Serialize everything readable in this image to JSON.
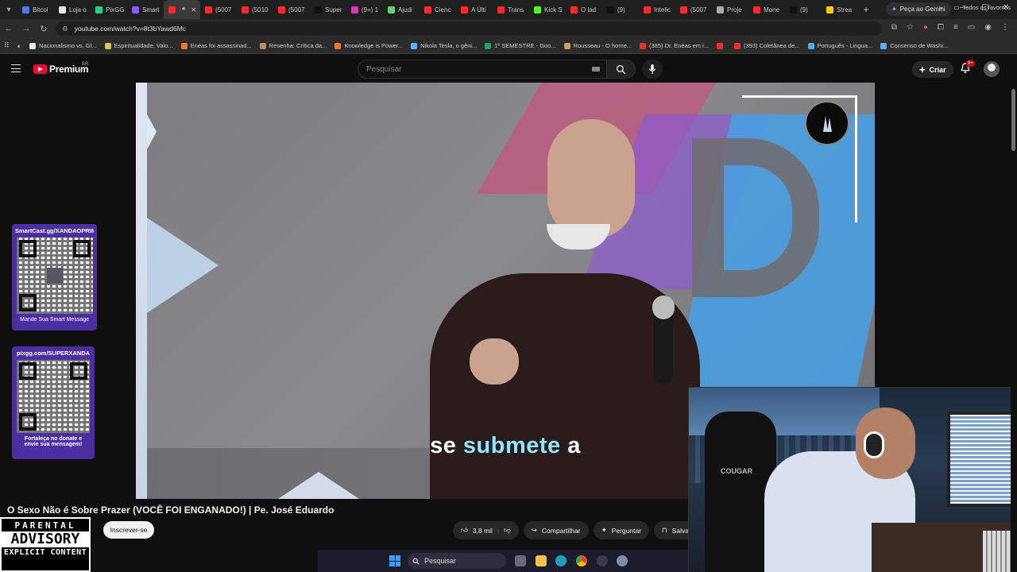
{
  "browser": {
    "tabs": [
      {
        "label": "Bitcoi",
        "color": "#4a7bf7"
      },
      {
        "label": "Loja o",
        "color": "#e8e8e8"
      },
      {
        "label": "PixGG",
        "color": "#2bd47a"
      },
      {
        "label": "Smart",
        "color": "#8a5cf5"
      },
      {
        "label": "",
        "color": "#ff2a2a",
        "active": true
      },
      {
        "label": "(5007",
        "color": "#ff2a2a"
      },
      {
        "label": "(5010",
        "color": "#ff2a2a"
      },
      {
        "label": "(5007",
        "color": "#ff2a2a"
      },
      {
        "label": "Super",
        "color": "#111111"
      },
      {
        "label": "(9+) 1",
        "color": "#d63ab8"
      },
      {
        "label": "Ajudi",
        "color": "#6cd16c"
      },
      {
        "label": "Cienc",
        "color": "#ff2a2a"
      },
      {
        "label": "A Últi",
        "color": "#ff2a2a"
      },
      {
        "label": "Trans",
        "color": "#ff2a2a"
      },
      {
        "label": "Kick S",
        "color": "#53fc18"
      },
      {
        "label": "O lad",
        "color": "#ff2a2a"
      },
      {
        "label": "(9)",
        "color": "#111111"
      },
      {
        "label": "Intelic",
        "color": "#ff2a2a"
      },
      {
        "label": "(5007",
        "color": "#ff2a2a"
      },
      {
        "label": "Proje",
        "color": "#aaaaaa"
      },
      {
        "label": "Mone",
        "color": "#ff2a2a"
      },
      {
        "label": "(9)",
        "color": "#111111"
      },
      {
        "label": "Strea",
        "color": "#f5d000"
      }
    ],
    "new_tab": "+",
    "gemini_label": "Peça ao Gemini",
    "window_controls": {
      "minimize": "—",
      "maximize": "▢",
      "close": "✕"
    },
    "url": "youtube.com/watch?v=8t3bYawd6Mc",
    "bookmarks": [
      {
        "label": "Nacionalismo vs. Gl...",
        "color": "#e8e8e8"
      },
      {
        "label": "Espiritualidade, Valo...",
        "color": "#d7c45a"
      },
      {
        "label": "Enéas foi assassinad...",
        "color": "#e8792c"
      },
      {
        "label": "Resenha: Crítica da...",
        "color": "#b88c6a"
      },
      {
        "label": "Knowledge is Power...",
        "color": "#e8792c"
      },
      {
        "label": "Nikola Tesla, o gêni...",
        "color": "#5ab0ff"
      },
      {
        "label": "1º SEMESTRE - Goo...",
        "color": "#1fa463"
      },
      {
        "label": "Rousseau - O home...",
        "color": "#c8a060"
      },
      {
        "label": "(385) Dr. Enéas em i...",
        "color": "#ff2a2a"
      },
      {
        "label": "",
        "color": "#ff2a2a"
      },
      {
        "label": "(393) Coletânea de...",
        "color": "#ff2a2a"
      },
      {
        "label": "Português - Lingua...",
        "color": "#4ab0e8"
      },
      {
        "label": "Consenso de Washi...",
        "color": "#5ab0ff"
      }
    ],
    "all_favorites": "Todos os favoritos"
  },
  "youtube": {
    "brand": "Premium",
    "region": "BR",
    "search_placeholder": "Pesquisar",
    "create_label": "Criar",
    "notifications_badge": "9+",
    "video": {
      "caption_word1": "se",
      "caption_word2": "submete",
      "caption_word3": "a",
      "title": "O Sexo Não é Sobre Prazer (VOCÊ FOI ENGANADO!) | Pe. José Eduardo",
      "subscribe_label": "Inscrever-se",
      "likes": "3,8 mil",
      "share_label": "Compartilhar",
      "ask_label": "Perguntar",
      "save_label": "Salva"
    }
  },
  "overlays": {
    "qr1": {
      "title": "SmartCast.gg/XANDAOPRIME",
      "caption": "Mande Sua Smart Message"
    },
    "qr2": {
      "title": "pixgg.com/SUPERXANDA",
      "caption_line1": "Fortaleça no donate e",
      "caption_line2": "envie sua mensagem!"
    },
    "advisory": {
      "line1": "PARENTAL",
      "line2": "ADVISORY",
      "line3": "EXPLICIT CONTENT"
    },
    "webcam_chair_brand": "COUGAR"
  },
  "taskbar": {
    "search_label": "Pesquisar"
  },
  "colors": {
    "youtube_red": "#ff0033",
    "caption_highlight": "#8ee6ff",
    "qr_card_bg": "#4b2fa0"
  }
}
